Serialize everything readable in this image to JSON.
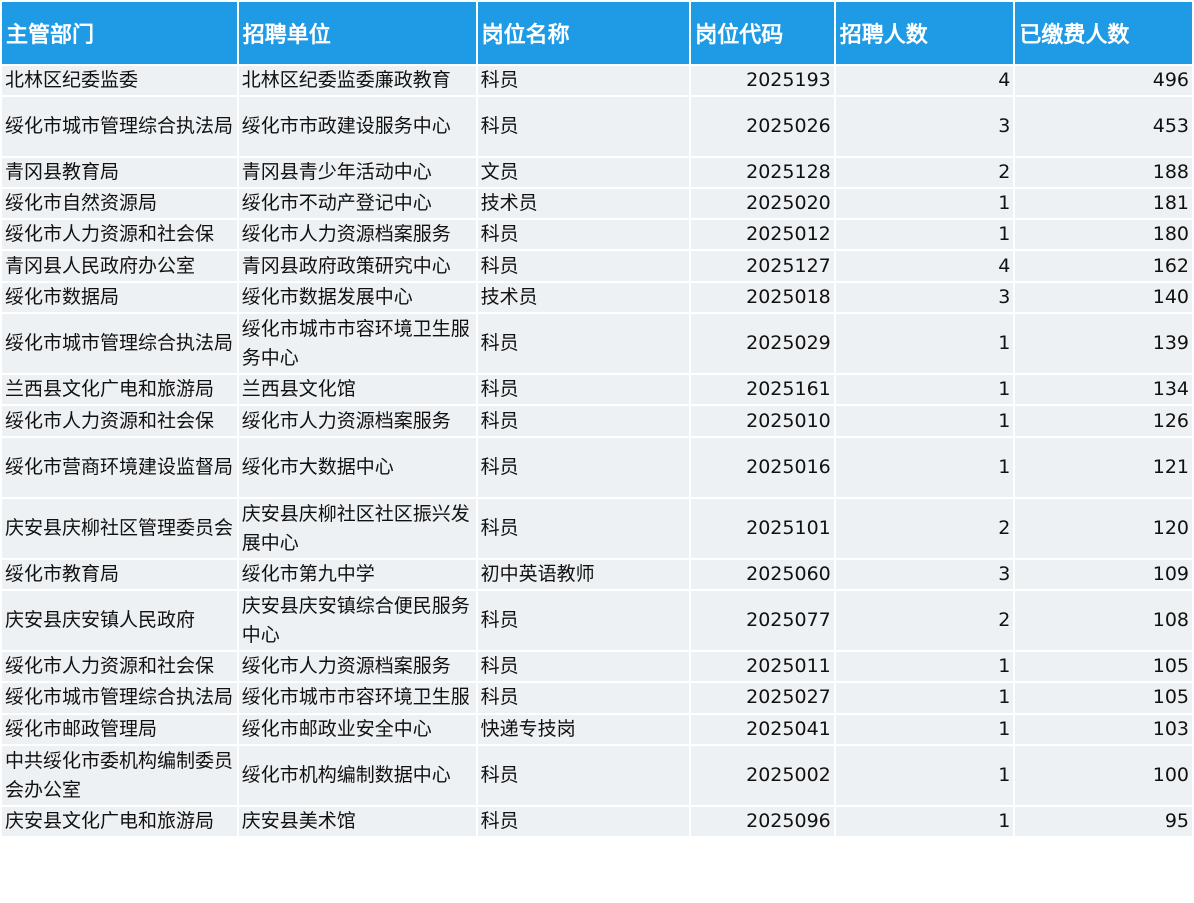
{
  "headers": [
    "主管部门",
    "招聘单位",
    "岗位名称",
    "岗位代码",
    "招聘人数",
    "已缴费人数"
  ],
  "rows": [
    {
      "dept": "北林区纪委监委",
      "unit": "北林区纪委监委廉政教育",
      "post": "科员",
      "code": "2025193",
      "hire": "4",
      "paid": "496"
    },
    {
      "dept": "绥化市城市管理综合执法局",
      "unit": "绥化市市政建设服务中心",
      "post": "科员",
      "code": "2025026",
      "hire": "3",
      "paid": "453"
    },
    {
      "dept": "青冈县教育局",
      "unit": "青冈县青少年活动中心",
      "post": "文员",
      "code": "2025128",
      "hire": "2",
      "paid": "188"
    },
    {
      "dept": "绥化市自然资源局",
      "unit": "绥化市不动产登记中心",
      "post": "技术员",
      "code": "2025020",
      "hire": "1",
      "paid": "181"
    },
    {
      "dept": "绥化市人力资源和社会保",
      "unit": "绥化市人力资源档案服务",
      "post": "科员",
      "code": "2025012",
      "hire": "1",
      "paid": "180"
    },
    {
      "dept": "青冈县人民政府办公室",
      "unit": "青冈县政府政策研究中心",
      "post": "科员",
      "code": "2025127",
      "hire": "4",
      "paid": "162"
    },
    {
      "dept": "绥化市数据局",
      "unit": "绥化市数据发展中心",
      "post": "技术员",
      "code": "2025018",
      "hire": "3",
      "paid": "140"
    },
    {
      "dept": "绥化市城市管理综合执法局",
      "unit": "绥化市城市市容环境卫生服务中心",
      "post": "科员",
      "code": "2025029",
      "hire": "1",
      "paid": "139"
    },
    {
      "dept": "兰西县文化广电和旅游局",
      "unit": "兰西县文化馆",
      "post": "科员",
      "code": "2025161",
      "hire": "1",
      "paid": "134"
    },
    {
      "dept": "绥化市人力资源和社会保",
      "unit": "绥化市人力资源档案服务",
      "post": "科员",
      "code": "2025010",
      "hire": "1",
      "paid": "126"
    },
    {
      "dept": "绥化市营商环境建设监督局",
      "unit": "绥化市大数据中心",
      "post": "科员",
      "code": "2025016",
      "hire": "1",
      "paid": "121"
    },
    {
      "dept": "庆安县庆柳社区管理委员会",
      "unit": "庆安县庆柳社区社区振兴发展中心",
      "post": "科员",
      "code": "2025101",
      "hire": "2",
      "paid": "120"
    },
    {
      "dept": "绥化市教育局",
      "unit": "绥化市第九中学",
      "post": "初中英语教师",
      "code": "2025060",
      "hire": "3",
      "paid": "109"
    },
    {
      "dept": "庆安县庆安镇人民政府",
      "unit": "庆安县庆安镇综合便民服务中心",
      "post": "科员",
      "code": "2025077",
      "hire": "2",
      "paid": "108"
    },
    {
      "dept": "绥化市人力资源和社会保",
      "unit": "绥化市人力资源档案服务",
      "post": "科员",
      "code": "2025011",
      "hire": "1",
      "paid": "105"
    },
    {
      "dept": "绥化市城市管理综合执法局",
      "unit": "绥化市城市市容环境卫生服务中心",
      "post": "科员",
      "code": "2025027",
      "hire": "1",
      "paid": "105"
    },
    {
      "dept": "绥化市邮政管理局",
      "unit": "绥化市邮政业安全中心",
      "post": "快递专技岗",
      "code": "2025041",
      "hire": "1",
      "paid": "103"
    },
    {
      "dept": "中共绥化市委机构编制委员会办公室",
      "unit": "绥化市机构编制数据中心",
      "post": "科员",
      "code": "2025002",
      "hire": "1",
      "paid": "100"
    },
    {
      "dept": "庆安县文化广电和旅游局",
      "unit": "庆安县美术馆",
      "post": "科员",
      "code": "2025096",
      "hire": "1",
      "paid": "95"
    }
  ]
}
